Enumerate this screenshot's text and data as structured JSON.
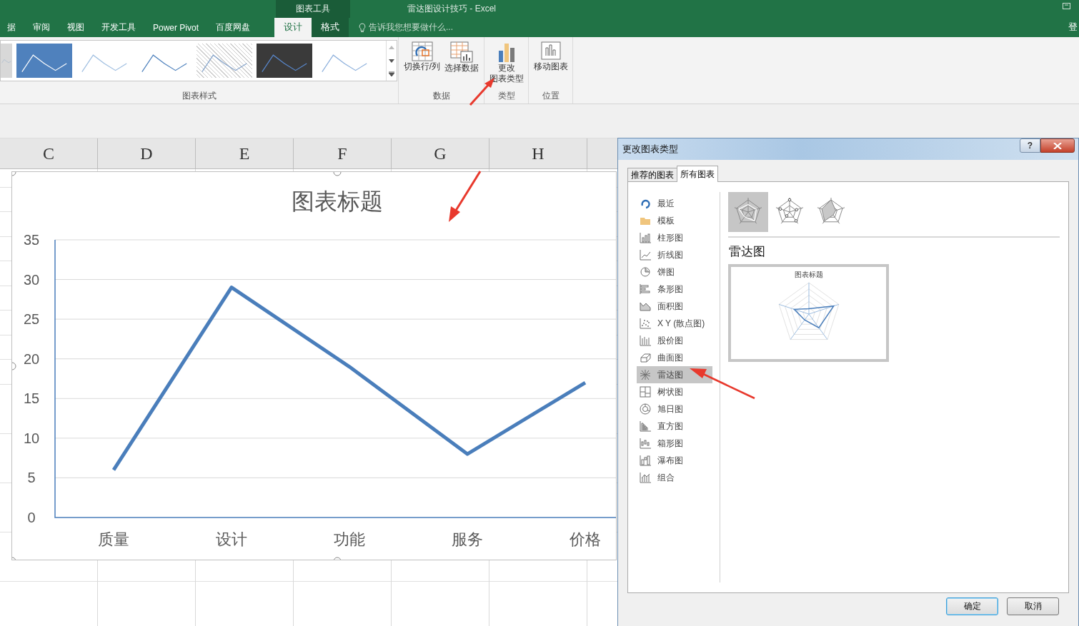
{
  "window": {
    "title": "雷达图设计技巧 - Excel",
    "context_label": "图表工具",
    "sign_in": "登"
  },
  "ribbon_tabs": [
    {
      "label": "据",
      "selected": false
    },
    {
      "label": "审阅",
      "selected": false
    },
    {
      "label": "视图",
      "selected": false
    },
    {
      "label": "开发工具",
      "selected": false
    },
    {
      "label": "Power Pivot",
      "selected": false
    },
    {
      "label": "百度网盘",
      "selected": false
    }
  ],
  "context_tabs": [
    {
      "label": "设计",
      "selected": true
    },
    {
      "label": "格式",
      "selected": false
    }
  ],
  "tell_me": {
    "placeholder": "告诉我您想要做什么..."
  },
  "chart_styles": {
    "label": "图表样式",
    "thumbnails": [
      {
        "kind": "partial"
      },
      {
        "kind": "blue"
      },
      {
        "kind": "plain"
      },
      {
        "kind": "outlined"
      },
      {
        "kind": "hatched"
      },
      {
        "kind": "dark"
      },
      {
        "kind": "markers"
      }
    ]
  },
  "ribbon_groups": [
    {
      "label": "数据",
      "buttons": [
        {
          "label": "切换行/列",
          "kind": "switch"
        },
        {
          "label": "选择数据",
          "kind": "select-data"
        }
      ]
    },
    {
      "label": "类型",
      "buttons": [
        {
          "lines": [
            "更改",
            "图表类型"
          ],
          "kind": "change-type"
        }
      ]
    },
    {
      "label": "位置",
      "buttons": [
        {
          "label": "移动图表",
          "kind": "move"
        }
      ]
    }
  ],
  "sheet": {
    "columns": [
      "C",
      "D",
      "E",
      "F",
      "G",
      "H"
    ]
  },
  "chart": {
    "chart_data": {
      "type": "line",
      "title": "图表标题",
      "categories": [
        "质量",
        "设计",
        "功能",
        "服务",
        "价格"
      ],
      "series": [
        {
          "color": "#4a7ebb",
          "values": [
            6,
            29,
            19,
            8,
            17
          ]
        }
      ],
      "grid": true,
      "ylim": [
        0,
        35
      ],
      "yticks": [
        0,
        5,
        10,
        15,
        20,
        25,
        30,
        35
      ]
    }
  },
  "dialog": {
    "title": "更改图表类型",
    "help": "?",
    "tabs": [
      {
        "label": "推荐的图表",
        "selected": false
      },
      {
        "label": "所有图表",
        "selected": true
      }
    ],
    "types": [
      {
        "label": "最近",
        "kind": "recent",
        "selected": false
      },
      {
        "label": "模板",
        "kind": "template",
        "selected": false
      },
      {
        "label": "柱形图",
        "kind": "column",
        "selected": false
      },
      {
        "label": "折线图",
        "kind": "line",
        "selected": false
      },
      {
        "label": "饼图",
        "kind": "pie",
        "selected": false
      },
      {
        "label": "条形图",
        "kind": "bar",
        "selected": false
      },
      {
        "label": "面积图",
        "kind": "area",
        "selected": false
      },
      {
        "label": "X Y (散点图)",
        "kind": "scatter",
        "selected": false
      },
      {
        "label": "股价图",
        "kind": "stock",
        "selected": false
      },
      {
        "label": "曲面图",
        "kind": "surface",
        "selected": false
      },
      {
        "label": "雷达图",
        "kind": "radar",
        "selected": true
      },
      {
        "label": "树状图",
        "kind": "treemap",
        "selected": false
      },
      {
        "label": "旭日图",
        "kind": "sunburst",
        "selected": false
      },
      {
        "label": "直方图",
        "kind": "histogram",
        "selected": false
      },
      {
        "label": "箱形图",
        "kind": "box",
        "selected": false
      },
      {
        "label": "瀑布图",
        "kind": "waterfall",
        "selected": false
      },
      {
        "label": "组合",
        "kind": "combo",
        "selected": false
      }
    ],
    "subtypes": [
      {
        "kind": "radar",
        "selected": true
      },
      {
        "kind": "markers",
        "selected": false
      },
      {
        "kind": "filled",
        "selected": false
      }
    ],
    "heading": "雷达图",
    "preview": {
      "title": "图表标题"
    },
    "buttons": [
      {
        "label": "确定",
        "kind": "primary"
      },
      {
        "label": "取消",
        "kind": "normal"
      }
    ]
  }
}
